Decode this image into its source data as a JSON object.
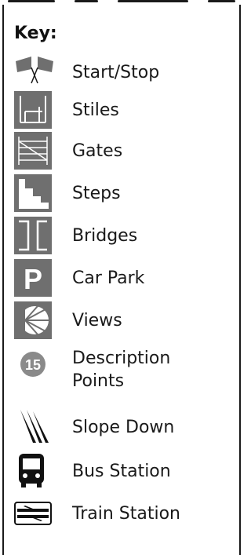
{
  "legend": {
    "title": "Key:",
    "items": [
      {
        "icon": "start-stop-flags-icon",
        "label": "Start/Stop"
      },
      {
        "icon": "stile-icon",
        "label": "Stiles"
      },
      {
        "icon": "gate-icon",
        "label": "Gates"
      },
      {
        "icon": "steps-icon",
        "label": "Steps"
      },
      {
        "icon": "bridge-icon",
        "label": "Bridges"
      },
      {
        "icon": "car-park-icon",
        "label": "Car Park"
      },
      {
        "icon": "views-icon",
        "label": "Views"
      },
      {
        "icon": "description-point-icon",
        "label": "Description Points",
        "badge": "15"
      },
      {
        "icon": "slope-down-icon",
        "label": "Slope Down"
      },
      {
        "icon": "bus-icon",
        "label": "Bus Station"
      },
      {
        "icon": "train-icon",
        "label": "Train Station"
      }
    ]
  },
  "colors": {
    "icon_grey": "#6f6f6f",
    "badge_grey": "#8a8a8a",
    "text": "#1a1a1a"
  }
}
